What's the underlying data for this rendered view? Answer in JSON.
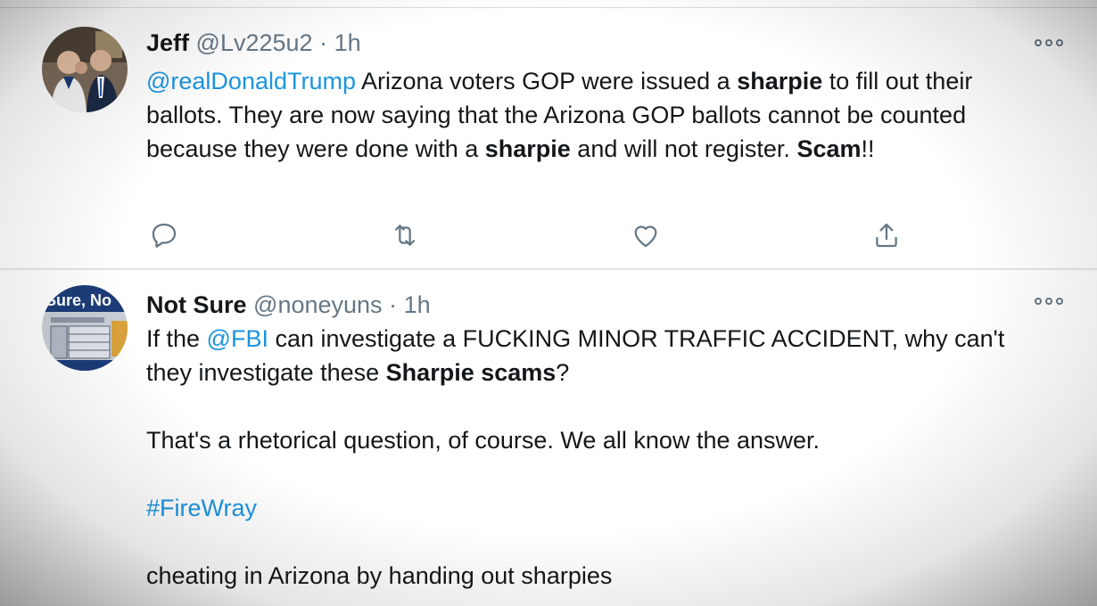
{
  "tweets": [
    {
      "name": "Jeff",
      "handle": "@Lv225u2",
      "separator": "·",
      "time": "1h",
      "mention": "@realDonaldTrump",
      "text_1": " Arizona voters GOP were issued a ",
      "bold_1": "sharpie",
      "text_2": " to fill out their ballots. They are now saying that the Arizona GOP ballots cannot be counted because they were done with a ",
      "bold_2": "sharpie",
      "text_3": " and will not register. ",
      "bold_3": "Scam",
      "text_4": "!!",
      "actions": [
        "reply-icon",
        "retweet-icon",
        "like-icon",
        "share-icon"
      ]
    },
    {
      "name": "Not Sure",
      "handle": "@noneyuns",
      "separator": "·",
      "time": "1h",
      "avatar_text": "Sure, No",
      "line1_a": "If the ",
      "line1_mention": "@FBI",
      "line1_b": " can investigate a FUCKING MINOR TRAFFIC ACCIDENT, why can't they investigate these ",
      "line1_bold": "Sharpie scams",
      "line1_c": "?",
      "line2": "That's a rhetorical question, of course. We all know the answer.",
      "hashtag": "#FireWray",
      "line4": "cheating in Arizona by handing out sharpies"
    }
  ],
  "colors": {
    "link": "#1b95e0",
    "secondary_text": "#657786",
    "primary_text": "#14171a"
  }
}
